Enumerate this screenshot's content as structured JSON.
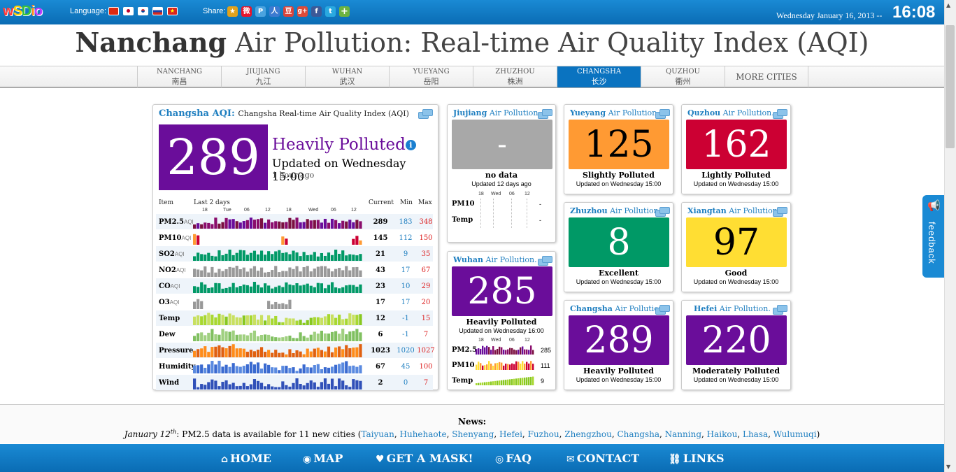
{
  "header": {
    "logo_text": "wSDio",
    "language_label": "Language:",
    "share_label": "Share:",
    "date": "Wednesday January 16, 2013 --",
    "time": "16:08",
    "flags": [
      {
        "name": "china-flag",
        "color": "#de2910"
      },
      {
        "name": "japan-flag",
        "color": "#ffffff"
      },
      {
        "name": "korea-flag",
        "color": "#ffffff"
      },
      {
        "name": "russia-flag",
        "color": "#1c3fa8"
      },
      {
        "name": "vietnam-flag",
        "color": "#da251d"
      }
    ],
    "share_icons": [
      {
        "name": "star-share-icon",
        "glyph": "★",
        "color": "#e2a21c"
      },
      {
        "name": "weibo-share-icon",
        "glyph": "微",
        "color": "#e6162d"
      },
      {
        "name": "pin-share-icon",
        "glyph": "P",
        "color": "#4aa3df"
      },
      {
        "name": "renren-share-icon",
        "glyph": "人",
        "color": "#3c7ad0"
      },
      {
        "name": "douban-share-icon",
        "glyph": "豆",
        "color": "#d9443b"
      },
      {
        "name": "google-plus-share-icon",
        "glyph": "g+",
        "color": "#dd4b39"
      },
      {
        "name": "facebook-share-icon",
        "glyph": "f",
        "color": "#3b5998"
      },
      {
        "name": "twitter-share-icon",
        "glyph": "t",
        "color": "#2aa9e0"
      },
      {
        "name": "plus-share-icon",
        "glyph": "+",
        "color": "#6cb33f"
      }
    ]
  },
  "title": {
    "city": "Nanchang",
    "rest": " Air Pollution: Real-time Air Quality Index (AQI)"
  },
  "tabs": [
    {
      "en": "NANCHANG",
      "zh": "南昌"
    },
    {
      "en": "JIUJIANG",
      "zh": "九江"
    },
    {
      "en": "WUHAN",
      "zh": "武汉"
    },
    {
      "en": "YUEYANG",
      "zh": "岳阳"
    },
    {
      "en": "ZHUZHOU",
      "zh": "株洲"
    },
    {
      "en": "CHANGSHA",
      "zh": "长沙"
    },
    {
      "en": "QUZHOU",
      "zh": "衢州"
    },
    {
      "en": "MORE CITIES",
      "zh": ""
    }
  ],
  "main": {
    "title_city": "Changsha AQI",
    "title_sep": ": ",
    "title_sub": "Changsha Real-time Air Quality Index (AQI)",
    "aqi": "289",
    "status": "Heavily Polluted",
    "info_glyph": "i",
    "updated": "Updated on Wednesday 15:00",
    "ago": "1 hour ago",
    "headers": {
      "item": "Item",
      "last": "Last 2 days",
      "current": "Current",
      "min": "Min",
      "max": "Max"
    },
    "ticks": [
      "18",
      "Tue",
      "06",
      "12",
      "18",
      "Wed",
      "06",
      "12"
    ],
    "rows": [
      {
        "label": "PM2.5",
        "aqi": "AQI",
        "current": "289",
        "min": "183",
        "max": "348"
      },
      {
        "label": "PM10",
        "aqi": "AQI",
        "current": "145",
        "min": "112",
        "max": "150"
      },
      {
        "label": "SO2",
        "aqi": "AQI",
        "current": "21",
        "min": "9",
        "max": "35"
      },
      {
        "label": "NO2",
        "aqi": "AQI",
        "current": "43",
        "min": "17",
        "max": "67"
      },
      {
        "label": "CO",
        "aqi": "AQI",
        "current": "23",
        "min": "10",
        "max": "29"
      },
      {
        "label": "O3",
        "aqi": "AQI",
        "current": "17",
        "min": "17",
        "max": "20"
      },
      {
        "label": "Temp",
        "aqi": "",
        "current": "12",
        "min": "-1",
        "max": "15"
      },
      {
        "label": "Dew",
        "aqi": "",
        "current": "6",
        "min": "-1",
        "max": "7"
      },
      {
        "label": "Pressure",
        "aqi": "",
        "current": "1023",
        "min": "1020",
        "max": "1027"
      },
      {
        "label": "Humidity",
        "aqi": "",
        "current": "67",
        "min": "45",
        "max": "100"
      },
      {
        "label": "Wind",
        "aqi": "",
        "current": "2",
        "min": "0",
        "max": "7"
      }
    ]
  },
  "cities": {
    "jiujiang": {
      "name": "Jiujiang",
      "suffix": " Air Pollution.",
      "aqi": "-",
      "status": "no data",
      "updated": "Updated 12 days ago",
      "color": "#a8a8a8",
      "ticks": [
        "18",
        "Wed",
        "06",
        "12"
      ],
      "rows": [
        {
          "label": "PM10",
          "value": "-"
        },
        {
          "label": "Temp",
          "value": "-"
        }
      ]
    },
    "wuhan": {
      "name": "Wuhan",
      "suffix": " Air Pollution.",
      "aqi": "285",
      "status": "Heavily Polluted",
      "updated": "Updated on Wednesday 16:00",
      "color": "#6a0d9a",
      "ticks": [
        "18",
        "Wed",
        "06",
        "12"
      ],
      "rows": [
        {
          "label": "PM2.5",
          "value": "285"
        },
        {
          "label": "PM10",
          "value": "111"
        },
        {
          "label": "Temp",
          "value": "9"
        }
      ]
    },
    "yueyang": {
      "name": "Yueyang",
      "suffix": " Air Pollution.",
      "aqi": "125",
      "status": "Slightly Polluted",
      "updated": "Updated on Wednesday 15:00",
      "color": "#ff9a33"
    },
    "quzhou": {
      "name": "Quzhou",
      "suffix": " Air Pollution.",
      "aqi": "162",
      "status": "Lightly Polluted",
      "updated": "Updated on Wednesday 15:00",
      "color": "#cc0033"
    },
    "zhuzhou": {
      "name": "Zhuzhou",
      "suffix": " Air Pollution.",
      "aqi": "8",
      "status": "Excellent",
      "updated": "Updated on Wednesday 15:00",
      "color": "#009966"
    },
    "xiangtan": {
      "name": "Xiangtan",
      "suffix": " Air Pollution.",
      "aqi": "97",
      "status": "Good",
      "updated": "Updated on Wednesday 15:00",
      "color": "#ffde33"
    },
    "changsha": {
      "name": "Changsha",
      "suffix": " Air Pollution",
      "aqi": "289",
      "status": "Heavily Polluted",
      "updated": "Updated on Wednesday 15:00",
      "color": "#6a0d9a"
    },
    "hefei": {
      "name": "Hefei",
      "suffix": " Air Pollution.",
      "aqi": "220",
      "status": "Moderately Polluted",
      "updated": "Updated on Wednesday 15:00",
      "color": "#6a0d9a"
    }
  },
  "feedback": {
    "label": "feedback",
    "icon_glyph": "📢"
  },
  "news": {
    "heading": "News:",
    "date_main": "January 12",
    "date_sup": "th",
    "text": ": PM2.5 data is available for 11 new cities (",
    "cities": [
      "Taiyuan",
      "Huhehaote",
      "Shenyang",
      "Hefei",
      "Fuzhou",
      "Zhengzhou",
      "Changsha",
      "Nanning",
      "Haikou",
      "Lhasa",
      "Wulumuqi"
    ],
    "close": ")"
  },
  "nav": [
    {
      "label": "HOME",
      "icon": "⌂",
      "name": "home"
    },
    {
      "label": "MAP",
      "icon": "◉",
      "name": "map"
    },
    {
      "label": "GET A MASK!",
      "icon": "♥",
      "name": "mask"
    },
    {
      "label": "FAQ",
      "icon": "◎",
      "name": "faq"
    },
    {
      "label": "CONTACT",
      "icon": "✉",
      "name": "contact"
    },
    {
      "label": "LINKS",
      "icon": "⛓",
      "name": "links"
    }
  ],
  "colors": {
    "brand_blue": "#1a8ad4",
    "heavily_polluted": "#6a0d9a",
    "link_blue": "#1f7fc0",
    "max_red": "#dd2222"
  }
}
